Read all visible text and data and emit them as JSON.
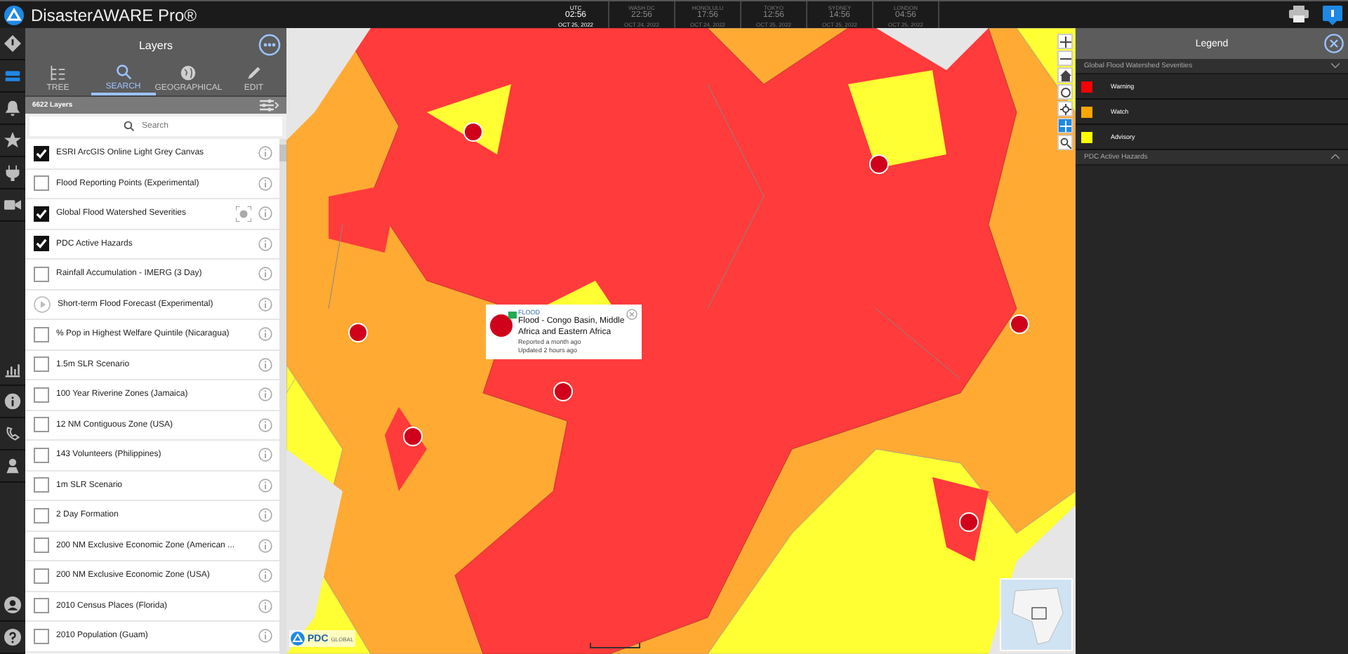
{
  "app": {
    "title": "DisasterAWARE Pro®"
  },
  "clocks": [
    {
      "zone": "UTC",
      "time": "02:56",
      "date": "OCT 25, 2022",
      "selected": true
    },
    {
      "zone": "WASH DC",
      "time": "22:56",
      "date": "OCT 24, 2022",
      "selected": false
    },
    {
      "zone": "HONOLULU",
      "time": "17:56",
      "date": "OCT 24, 2022",
      "selected": false
    },
    {
      "zone": "TOKYO",
      "time": "12:56",
      "date": "OCT 25, 2022",
      "selected": false
    },
    {
      "zone": "SYDNEY",
      "time": "14:56",
      "date": "OCT 25, 2022",
      "selected": false
    },
    {
      "zone": "LONDON",
      "time": "04:56",
      "date": "OCT 25, 2022",
      "selected": false
    }
  ],
  "rail": {
    "top": [
      {
        "kind": "diamond",
        "selected": false
      },
      {
        "kind": "layers",
        "selected": true
      },
      {
        "kind": "bell",
        "selected": false
      },
      {
        "kind": "star",
        "selected": false
      },
      {
        "kind": "plug",
        "selected": false
      },
      {
        "kind": "video",
        "selected": false
      }
    ],
    "bottom": [
      {
        "kind": "chart",
        "selected": false
      },
      {
        "kind": "info",
        "selected": false
      },
      {
        "kind": "phone",
        "selected": false
      },
      {
        "kind": "pin",
        "selected": false
      }
    ],
    "footer": [
      {
        "kind": "user",
        "selected": false
      },
      {
        "kind": "help",
        "selected": false
      }
    ]
  },
  "layers_panel": {
    "title": "Layers",
    "tabs": [
      {
        "label": "TREE",
        "kind": "tree",
        "selected": false
      },
      {
        "label": "SEARCH",
        "kind": "search",
        "selected": true
      },
      {
        "label": "GEOGRAPHICAL",
        "kind": "globe",
        "selected": false
      },
      {
        "label": "EDIT",
        "kind": "pen",
        "selected": false
      }
    ],
    "count": "6622 Layers",
    "search": {
      "placeholder": "Search"
    },
    "layers": [
      {
        "name": "ESRI ArcGIS Online Light Grey Canvas",
        "kind": "checkbox",
        "checked": true,
        "focus": false
      },
      {
        "name": "Flood Reporting Points (Experimental)",
        "kind": "checkbox",
        "checked": false,
        "focus": false
      },
      {
        "name": "Global Flood Watershed Severities",
        "kind": "checkbox",
        "checked": true,
        "focus": true
      },
      {
        "name": "PDC Active Hazards",
        "kind": "checkbox",
        "checked": true,
        "focus": false
      },
      {
        "name": "Rainfall Accumulation - IMERG (3 Day)",
        "kind": "checkbox",
        "checked": false,
        "focus": false
      },
      {
        "name": "Short-term Flood Forecast (Experimental)",
        "kind": "play",
        "checked": false,
        "focus": false
      },
      {
        "name": "% Pop in Highest Welfare Quintile (Nicaragua)",
        "kind": "checkbox",
        "checked": false,
        "focus": false
      },
      {
        "name": "1.5m SLR Scenario",
        "kind": "checkbox",
        "checked": false,
        "focus": false
      },
      {
        "name": "100 Year Riverine Zones (Jamaica)",
        "kind": "checkbox",
        "checked": false,
        "focus": false
      },
      {
        "name": "12 NM Contiguous Zone (USA)",
        "kind": "checkbox",
        "checked": false,
        "focus": false
      },
      {
        "name": "143 Volunteers (Philippines)",
        "kind": "checkbox",
        "checked": false,
        "focus": false
      },
      {
        "name": "1m SLR Scenario",
        "kind": "checkbox",
        "checked": false,
        "focus": false
      },
      {
        "name": "2 Day Formation",
        "kind": "checkbox",
        "checked": false,
        "focus": false
      },
      {
        "name": "200 NM Exclusive Economic Zone (American ...",
        "kind": "checkbox",
        "checked": false,
        "focus": false
      },
      {
        "name": "200 NM Exclusive Economic Zone (USA)",
        "kind": "checkbox",
        "checked": false,
        "focus": false
      },
      {
        "name": "2010 Census Places (Florida)",
        "kind": "checkbox",
        "checked": false,
        "focus": false
      },
      {
        "name": "2010 Population (Guam)",
        "kind": "checkbox",
        "checked": false,
        "focus": false
      }
    ]
  },
  "popup": {
    "category": "FLOOD",
    "title": "Flood - Congo Basin, Middle Africa and Eastern Africa",
    "reported": "Reported a month ago",
    "updated": "Updated 2 hours ago"
  },
  "map": {
    "logo": "PDC",
    "logo_sub": "GLOBAL"
  },
  "legend": {
    "title": "Legend",
    "sections": [
      {
        "title": "Global Flood Watershed Severities",
        "expanded": true,
        "items": [
          {
            "label": "Warning",
            "color": "#ff0000"
          },
          {
            "label": "Watch",
            "color": "#ffa500"
          },
          {
            "label": "Advisory",
            "color": "#ffff00"
          }
        ]
      },
      {
        "title": "PDC Active Hazards",
        "expanded": false
      }
    ]
  }
}
